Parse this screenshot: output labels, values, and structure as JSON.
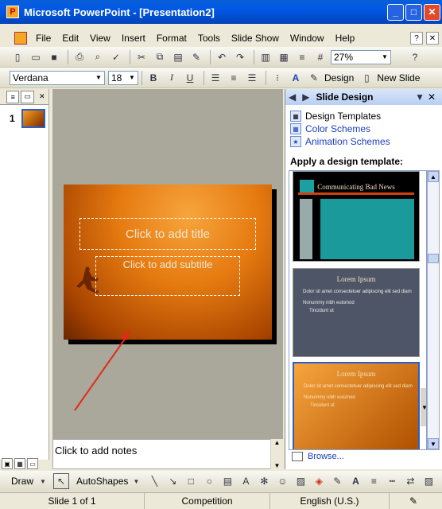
{
  "window": {
    "title": "Microsoft PowerPoint - [Presentation2]"
  },
  "menu": [
    "File",
    "Edit",
    "View",
    "Insert",
    "Format",
    "Tools",
    "Slide Show",
    "Window",
    "Help"
  ],
  "toolbar": {
    "zoom": "27%",
    "font": "Verdana",
    "size": "18",
    "design_label": "Design",
    "new_slide_label": "New Slide"
  },
  "slides_panel": {
    "slide_number": "1"
  },
  "slide": {
    "title_placeholder": "Click to add title",
    "subtitle_placeholder": "Click to add subtitle"
  },
  "notes": {
    "placeholder": "Click to add notes"
  },
  "task_pane": {
    "title": "Slide Design",
    "links": [
      "Design Templates",
      "Color Schemes",
      "Animation Schemes"
    ],
    "apply_label": "Apply a design template:",
    "templates": [
      {
        "title": "Communicating Bad News"
      },
      {
        "title": "Lorem Ipsum",
        "body": [
          "Dolor sit amet consectetuer adipiscing elit sed diam",
          "Nonummy nibh euismod",
          "Tincidunt ut"
        ]
      },
      {
        "title": "Lorem Ipsum",
        "body": [
          "Dolor sit amet consectetuer adipiscing elit sed diam",
          "Nonummy nibh euismod",
          "Tincidunt ut"
        ]
      }
    ],
    "browse": "Browse..."
  },
  "drawing": {
    "draw": "Draw",
    "autoshapes": "AutoShapes"
  },
  "status": {
    "slide": "Slide 1 of 1",
    "design": "Competition",
    "language": "English (U.S.)"
  },
  "accent": "#0058e6"
}
